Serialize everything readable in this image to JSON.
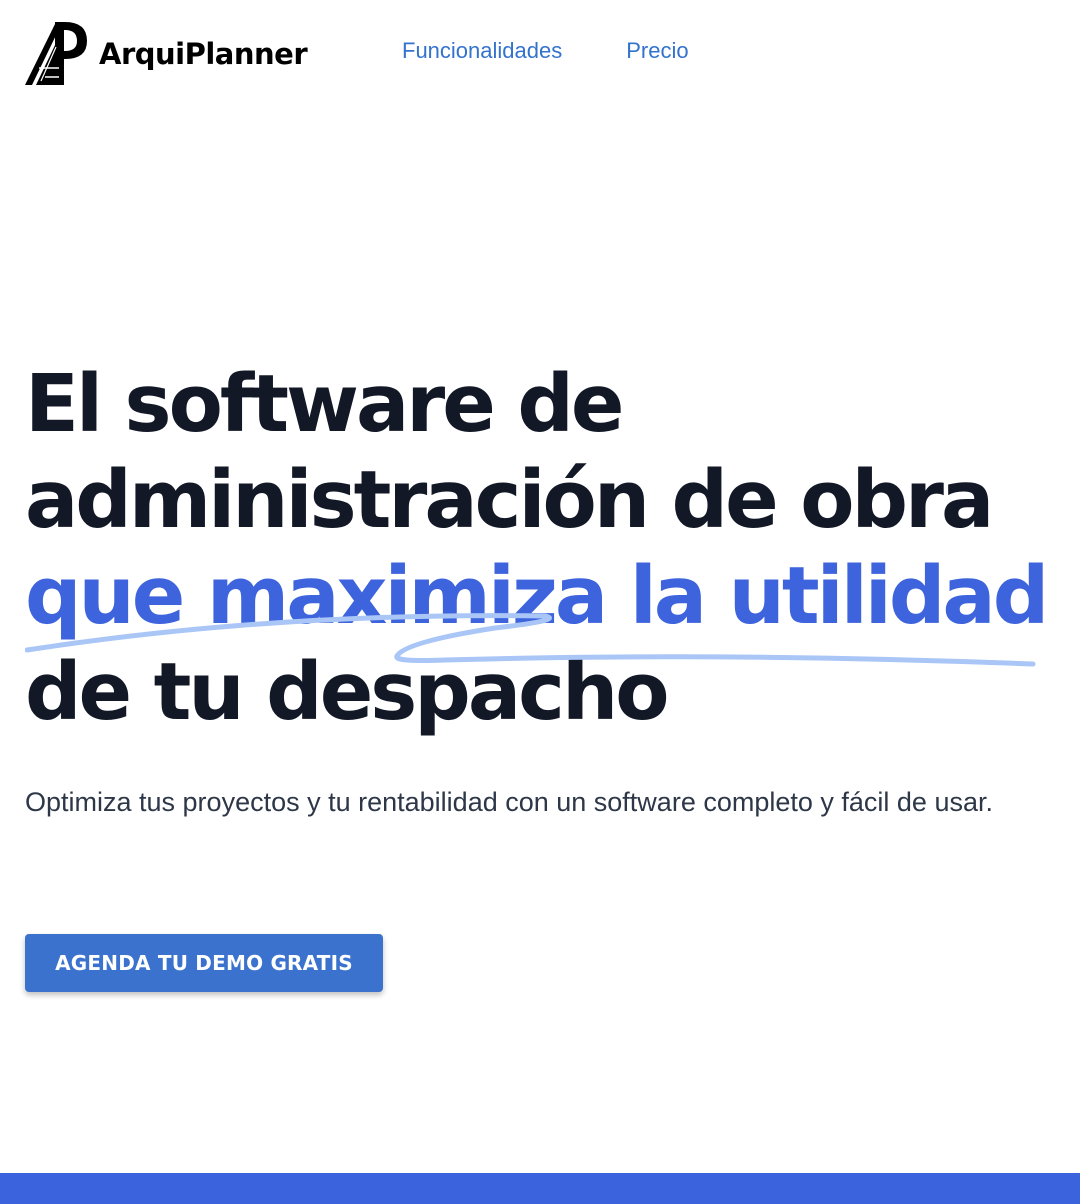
{
  "brand": {
    "name": "ArquiPlanner"
  },
  "nav": {
    "items": [
      {
        "label": "Funcionalidades"
      },
      {
        "label": "Precio"
      }
    ]
  },
  "hero": {
    "title_lines": [
      "El software de",
      "administración de obra",
      "que maximiza la utilidad",
      "de tu despacho"
    ],
    "subtitle": "Optimiza tus proyectos y tu rentabilidad con un software completo y fácil de usar.",
    "cta_label": "AGENDA TU DEMO GRATIS"
  },
  "colors": {
    "accent": "#3d63dd",
    "link": "#3373cc",
    "button": "#3a72cd",
    "heading": "#121826",
    "underline": "#a9c6f7",
    "band": "#3b63dd"
  }
}
